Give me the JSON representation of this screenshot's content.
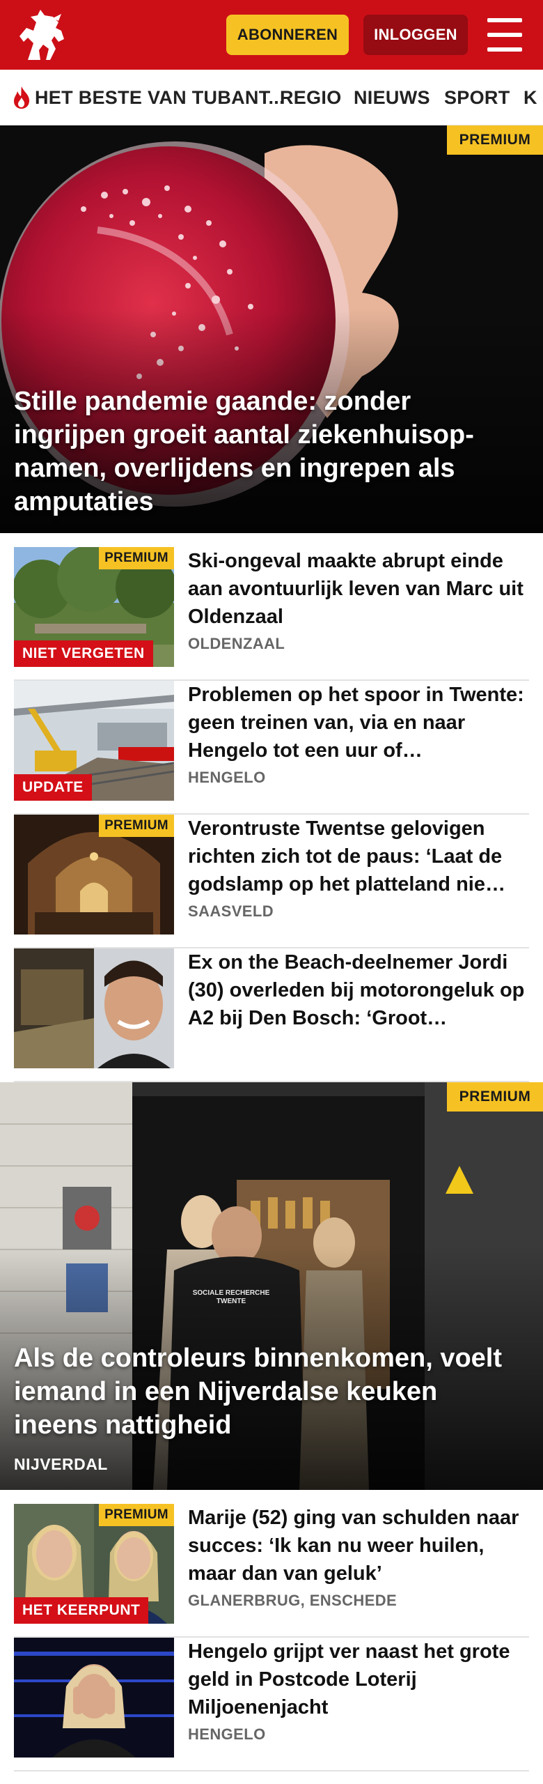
{
  "header": {
    "subscribe_label": "ABONNEREN",
    "login_label": "INLOGGEN",
    "brand_color": "#cc0f17",
    "logo_icon": "horse-logo-icon",
    "menu_icon": "hamburger-menu-icon"
  },
  "nav": {
    "items": [
      {
        "label": "HET BESTE VAN TUBANT...",
        "icon": "flame-icon"
      },
      {
        "label": "REGIO"
      },
      {
        "label": "NIEUWS"
      },
      {
        "label": "SPORT"
      },
      {
        "label": "K"
      }
    ]
  },
  "premium_label": "PREMIUM",
  "hero1": {
    "title": "Stille pandemie gaande: zonder ingrijpen groeit aantal ziekenhuisop­namen, overlijdens en ingrepen als amputaties"
  },
  "articles1": [
    {
      "title": "Ski-ongeval maakte abrupt einde aan avontuurlijk leven van Marc uit Oldenzaal",
      "location": "OLDENZAAL",
      "badge": "NIET VERGETEN",
      "premium": true
    },
    {
      "title": "Problemen op het spoor in Twente: geen treinen van, via en naar Hengelo tot een uur of…",
      "location": "HENGELO",
      "badge": "UPDATE",
      "premium": false
    },
    {
      "title": "Verontruste Twentse gelovigen richten zich tot de paus: ‘Laat de godslamp op het platteland nie…",
      "location": "SAASVELD",
      "badge": "",
      "premium": true
    },
    {
      "title": "Ex on the Beach-deelnemer Jordi (30) overleden bij motorongeluk op A2 bij Den Bosch: ‘Groot…",
      "location": "",
      "badge": "",
      "premium": false
    }
  ],
  "hero2": {
    "title": "Als de controleurs binnenkomen, voelt iemand in een Nijverdalse keuken ineens nattigheid",
    "location": "NIJVERDAL",
    "vest_text": "SOCIALE RECHERCHE TWENTE"
  },
  "articles2": [
    {
      "title": "Marije (52) ging van schulden naar succes: ‘Ik kan nu weer huilen, maar dan van geluk’",
      "location": "GLANERBRUG, ENSCHEDE",
      "badge": "HET KEERPUNT",
      "premium": true
    },
    {
      "title": "Hengelo grijpt ver naast het grote geld in Postcode Loterij Miljoenenjacht",
      "location": "HENGELO",
      "badge": "",
      "premium": false
    }
  ]
}
